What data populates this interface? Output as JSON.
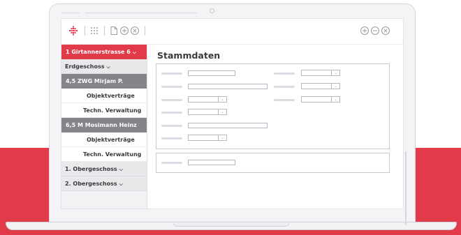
{
  "colors": {
    "accent": "#e13a48",
    "selected_dark": "#848489",
    "sidebar_bg": "#f2f2f4"
  },
  "toolbar": {
    "logo_icon": "diamond-logo-icon",
    "left_icons": [
      "grid-dots-icon",
      "document-icon",
      "plus-circle-icon",
      "close-circle-icon"
    ],
    "right_icons": [
      "plus-circle-icon",
      "minus-circle-icon",
      "close-circle-icon"
    ]
  },
  "sidebar": {
    "items": [
      {
        "label": "1 Girtannerstrasse 6",
        "chevron": "⌵"
      },
      {
        "label": "Erdgeschoss",
        "chevron": "⌵"
      },
      {
        "label": "4,5 ZWG Mirjam P."
      },
      {
        "label": "Objektverträge"
      },
      {
        "label": "Techn. Verwaltung"
      },
      {
        "label": "6,5 M Mosimann Heinz"
      },
      {
        "label": "Objektverträge"
      },
      {
        "label": "Techn. Verwaltung"
      },
      {
        "label": "1. Obergeschoss",
        "chevron": "⌵"
      },
      {
        "label": "2. Obergeschoss",
        "chevron": "⌵"
      }
    ]
  },
  "main": {
    "title": "Stammdaten"
  }
}
